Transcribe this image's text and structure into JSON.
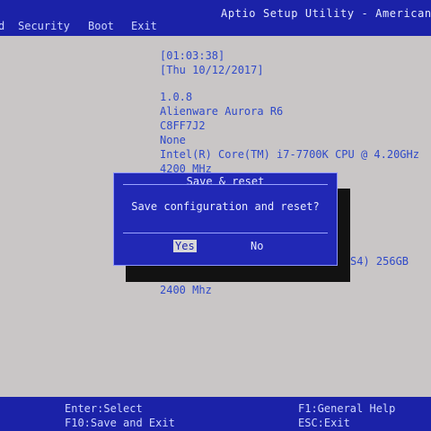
{
  "header": {
    "title": "Aptio Setup Utility - American",
    "tabs": [
      "d",
      "Security",
      "Boot",
      "Exit"
    ]
  },
  "main": {
    "time": "[01:03:38]",
    "date": "[Thu 10/12/2017]",
    "bios_version": "1.0.8",
    "model": "Alienware Aurora R6",
    "service_tag": "C8FF7J2",
    "asset_tag": "None",
    "cpu": "Intel(R) Core(TM) i7-7700K CPU @ 4.20GHz",
    "cpu_speed": "4200 MHz",
    "storage_partial": "S4) 256GB",
    "memory_speed": "2400 Mhz"
  },
  "dialog": {
    "title": "Save & reset",
    "message": "Save configuration and reset?",
    "yes_label": "Yes",
    "no_label": "No"
  },
  "footer": {
    "enter_select": "Enter:Select",
    "f10_save": "F10:Save and Exit",
    "f1_help": "F1:General Help",
    "esc_exit": "ESC:Exit"
  }
}
